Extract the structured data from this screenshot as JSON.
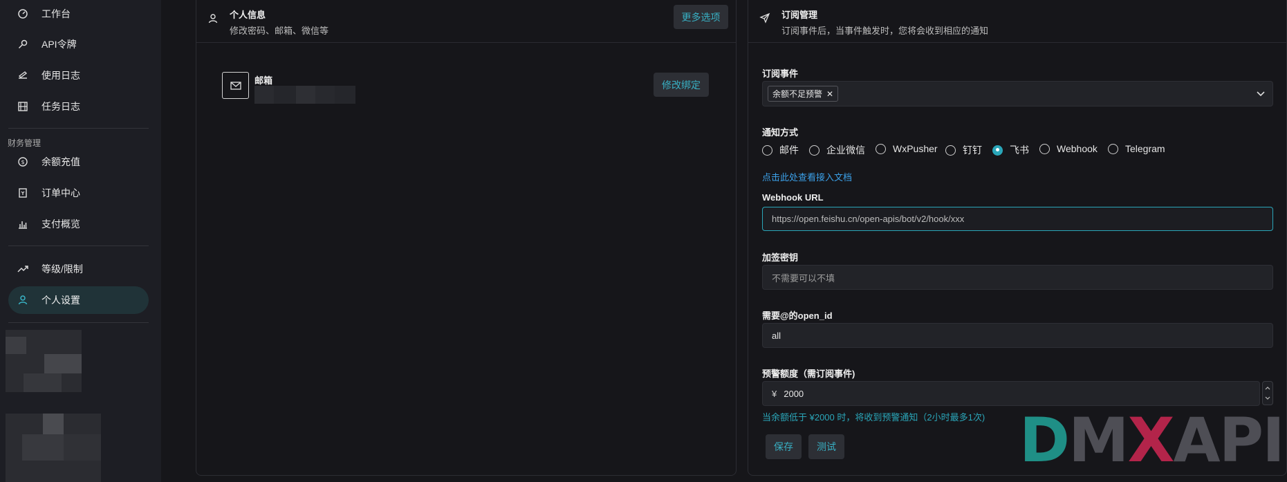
{
  "sidebar": {
    "items": [
      {
        "label": "工作台",
        "icon": "dashboard-icon"
      },
      {
        "label": "API令牌",
        "icon": "key-icon"
      },
      {
        "label": "使用日志",
        "icon": "log-icon"
      },
      {
        "label": "任务日志",
        "icon": "film-icon"
      }
    ],
    "finance_title": "财务管理",
    "finance_items": [
      {
        "label": "余额充值",
        "icon": "coin-icon"
      },
      {
        "label": "订单中心",
        "icon": "order-icon"
      },
      {
        "label": "支付概览",
        "icon": "chart-bar-icon"
      }
    ],
    "other_items": [
      {
        "label": "等级/限制",
        "icon": "trending-up-icon"
      },
      {
        "label": "个人设置",
        "icon": "user-icon"
      }
    ]
  },
  "profile": {
    "title": "个人信息",
    "subtitle": "修改密码、邮箱、微信等",
    "more_button": "更多选项",
    "email_label": "邮箱",
    "bind_button": "修改绑定"
  },
  "subscription": {
    "title": "订阅管理",
    "subtitle": "订阅事件后，当事件触发时，您将会收到相应的通知",
    "events_label": "订阅事件",
    "event_tag": "余额不足预警",
    "method_label": "通知方式",
    "methods": [
      "邮件",
      "企业微信",
      "WxPusher",
      "钉钉",
      "飞书",
      "Webhook",
      "Telegram"
    ],
    "selected_method": "飞书",
    "doc_link": "点击此处查看接入文档",
    "webhook_label": "Webhook URL",
    "webhook_value": "https://open.feishu.cn/open-apis/bot/v2/hook/xxx",
    "secret_label": "加签密钥",
    "secret_placeholder": "不需要可以不填",
    "openid_label": "需要@的open_id",
    "openid_value": "all",
    "threshold_label": "预警额度（需订阅事件)",
    "currency_symbol": "¥",
    "threshold_value": "2000",
    "threshold_hint": "当余额低于 ¥2000 时，将收到预警通知（2小时最多1次)",
    "save_button": "保存",
    "test_button": "测试"
  },
  "logo": {
    "d": "D",
    "m": "M",
    "x": "X",
    "api": "API",
    "color_d": "#1f8f86",
    "color_m": "#4e4e55",
    "color_x": "#b3244a",
    "color_api": "#4e4e55"
  }
}
